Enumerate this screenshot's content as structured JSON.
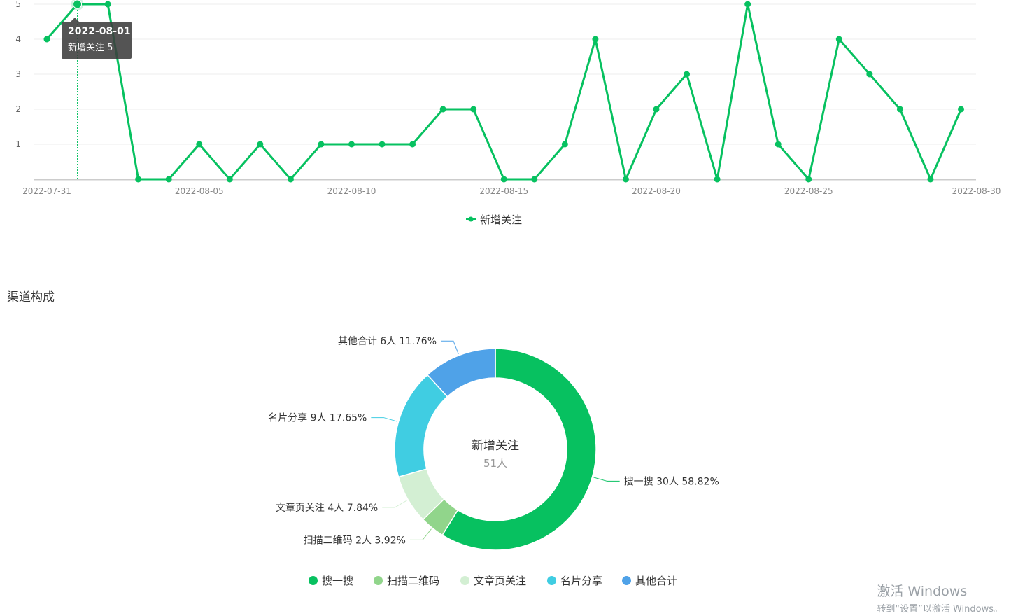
{
  "chart_data": [
    {
      "type": "line",
      "x": [
        "2022-07-31",
        "2022-08-01",
        "2022-08-02",
        "2022-08-03",
        "2022-08-04",
        "2022-08-05",
        "2022-08-06",
        "2022-08-07",
        "2022-08-08",
        "2022-08-09",
        "2022-08-10",
        "2022-08-11",
        "2022-08-12",
        "2022-08-13",
        "2022-08-14",
        "2022-08-15",
        "2022-08-16",
        "2022-08-17",
        "2022-08-18",
        "2022-08-19",
        "2022-08-20",
        "2022-08-21",
        "2022-08-22",
        "2022-08-23",
        "2022-08-24",
        "2022-08-25",
        "2022-08-26",
        "2022-08-27",
        "2022-08-28",
        "2022-08-29",
        "2022-08-30"
      ],
      "series": [
        {
          "name": "新增关注",
          "color": "#07c160",
          "values": [
            4,
            5,
            5,
            0,
            0,
            1,
            0,
            1,
            0,
            1,
            1,
            1,
            1,
            2,
            2,
            0,
            0,
            1,
            4,
            0,
            2,
            3,
            0,
            5,
            1,
            0,
            4,
            3,
            2,
            0,
            2
          ]
        }
      ],
      "x_tick_labels": [
        "2022-07-31",
        "2022-08-05",
        "2022-08-10",
        "2022-08-15",
        "2022-08-20",
        "2022-08-25",
        "2022-08-30"
      ],
      "y_tick_labels": [
        "1",
        "2",
        "3",
        "4",
        "5"
      ],
      "ylim": [
        0,
        5
      ],
      "grid": true,
      "legend_position": "bottom-center",
      "tooltip": {
        "date": "2022-08-01",
        "text": "新增关注 5"
      }
    },
    {
      "type": "pie",
      "title": "渠道构成",
      "center_label": "新增关注",
      "center_value": "51人",
      "slices": [
        {
          "name": "搜一搜",
          "value": 30,
          "label": "搜一搜 30人 58.82%",
          "color": "#07c160"
        },
        {
          "name": "扫描二维码",
          "value": 2,
          "label": "扫描二维码 2人 3.92%",
          "color": "#91d58b"
        },
        {
          "name": "文章页关注",
          "value": 4,
          "label": "文章页关注 4人 7.84%",
          "color": "#d3efd3"
        },
        {
          "name": "名片分享",
          "value": 9,
          "label": "名片分享 9人 17.65%",
          "color": "#40cde2"
        },
        {
          "name": "其他合计",
          "value": 6,
          "label": "其他合计 6人 11.76%",
          "color": "#4fa2e8"
        }
      ],
      "legend_position": "bottom-center"
    }
  ],
  "section_title": "渠道构成",
  "watermark": {
    "line1": "激活 Windows",
    "line2": "转到“设置”以激活 Windows。"
  }
}
